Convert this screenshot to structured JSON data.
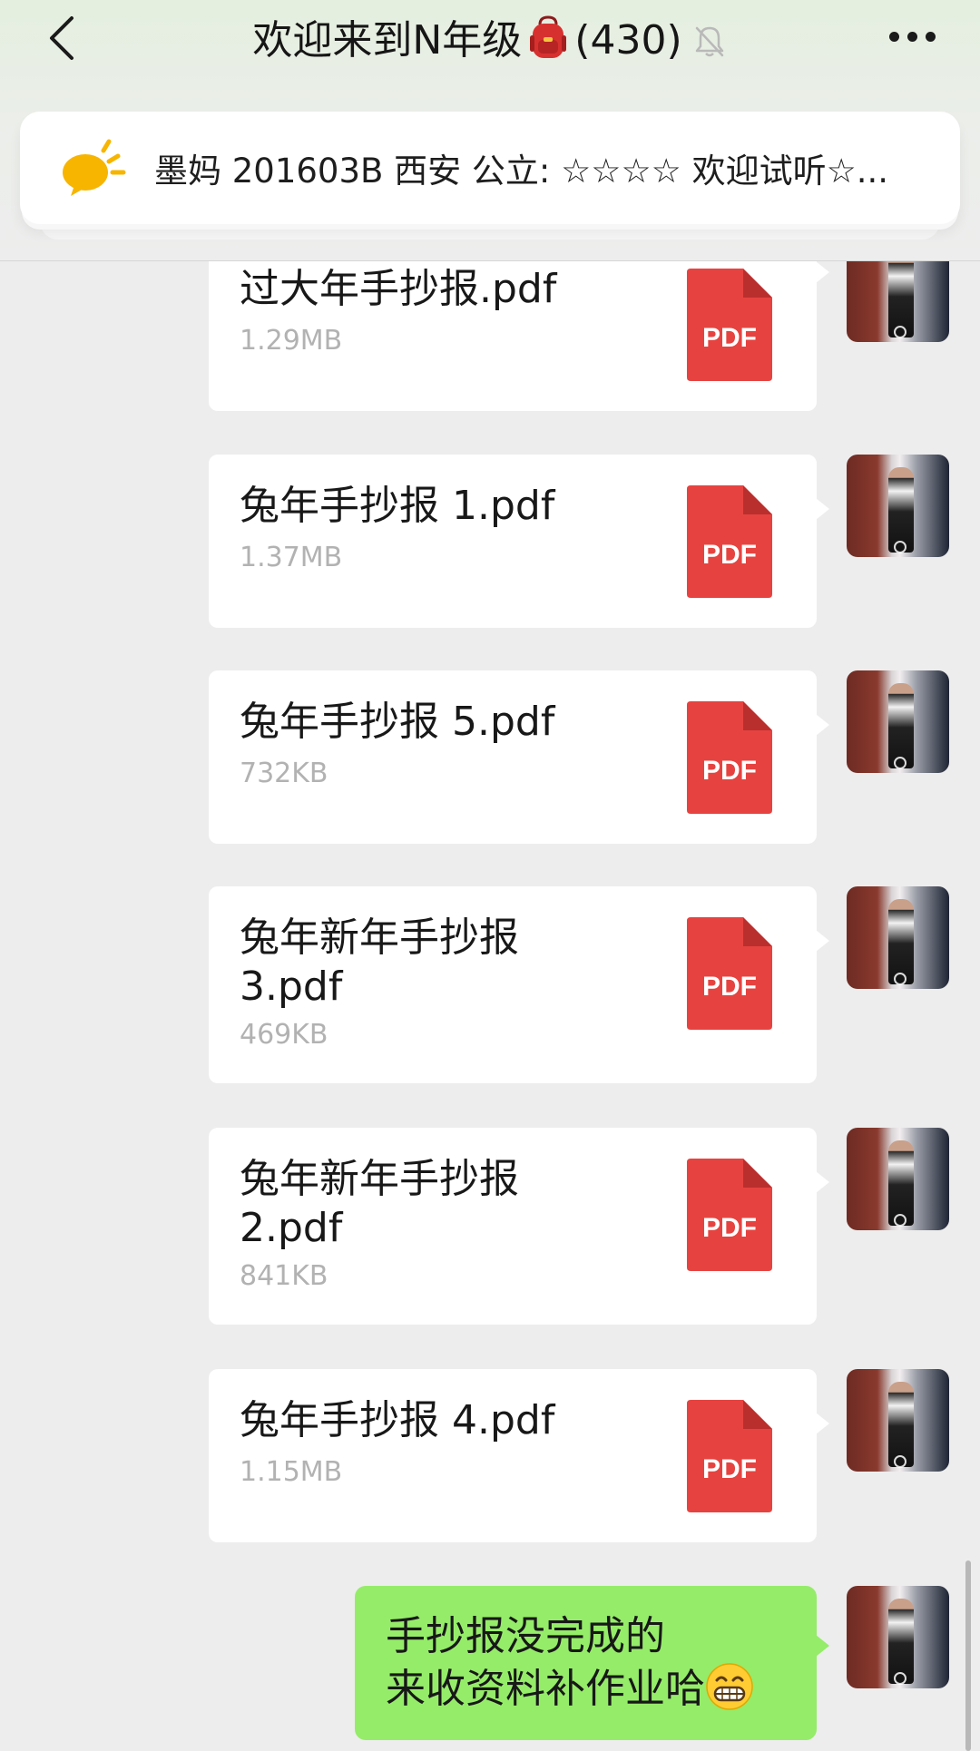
{
  "header": {
    "title_prefix": "欢迎来到N年级",
    "title_count": "(430)",
    "backpack_icon": "backpack-emoji",
    "mute_icon": "bell-off-icon"
  },
  "notice": {
    "icon": "announcement-bulb-icon",
    "text": "墨妈 201603B 西安 公立: ☆☆☆☆ 欢迎试听☆..."
  },
  "files": [
    {
      "name": "过大年手抄报.pdf",
      "size": "1.29MB",
      "type_label": "PDF"
    },
    {
      "name": "兔年手抄报 1.pdf",
      "size": "1.37MB",
      "type_label": "PDF"
    },
    {
      "name": "兔年手抄报 5.pdf",
      "size": "732KB",
      "type_label": "PDF"
    },
    {
      "name": "兔年新年手抄报 3.pdf",
      "size": "469KB",
      "type_label": "PDF"
    },
    {
      "name": "兔年新年手抄报 2.pdf",
      "size": "841KB",
      "type_label": "PDF"
    },
    {
      "name": "兔年手抄报 4.pdf",
      "size": "1.15MB",
      "type_label": "PDF"
    }
  ],
  "last_message": {
    "line1": "手抄报没完成的",
    "line2": "来收资料补作业哈",
    "emoji": "grinning-face-emoji"
  },
  "colors": {
    "bubble_green": "#95ec69",
    "pdf_red": "#e64340",
    "background": "#ededed"
  }
}
